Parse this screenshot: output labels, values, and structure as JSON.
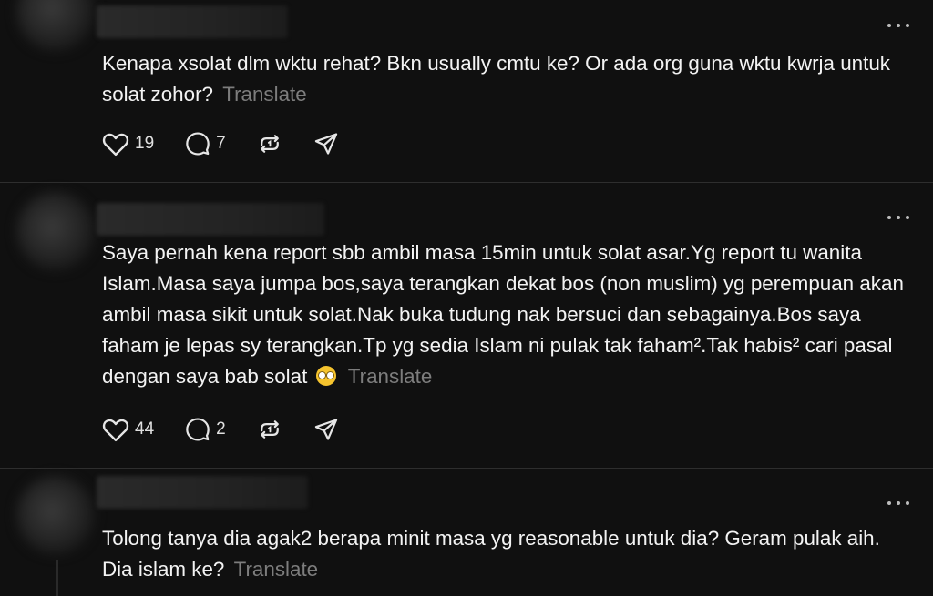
{
  "posts": [
    {
      "text": "Kenapa xsolat dlm wktu rehat? Bkn usually cmtu ke? Or ada org guna wktu kwrja untuk solat zohor?",
      "translate": "Translate",
      "likes": "19",
      "replies": "7"
    },
    {
      "text": "Saya pernah kena report sbb ambil masa 15min untuk solat asar.Yg report tu wanita Islam.Masa saya jumpa bos,saya terangkan dekat bos (non muslim) yg perempuan akan ambil masa sikit untuk solat.Nak buka tudung nak bersuci dan sebagainya.Bos saya faham je lepas sy terangkan.Tp yg sedia Islam ni pulak tak faham².Tak habis² cari pasal dengan saya bab solat",
      "emoji": "face-with-rolling-eyes",
      "translate": "Translate",
      "likes": "44",
      "replies": "2"
    },
    {
      "text": "Tolong tanya dia agak2 berapa minit masa yg reasonable untuk dia? Geram pulak aih. Dia islam ke?",
      "translate": "Translate"
    }
  ],
  "icons": {
    "like": "heart-icon",
    "reply": "comment-bubble-icon",
    "repost": "repost-icon",
    "share": "send-icon",
    "more": "more-dots-icon"
  },
  "colors": {
    "background": "#101010",
    "text": "#f3f3f3",
    "muted": "#7d7d7d",
    "divider": "#2e2e2e"
  }
}
